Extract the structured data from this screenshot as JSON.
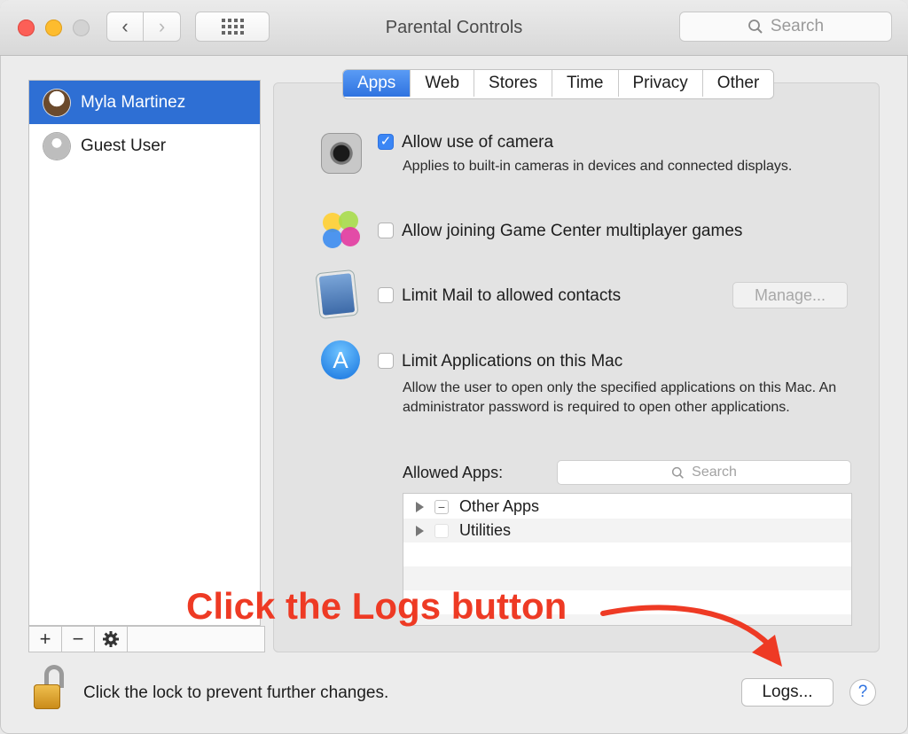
{
  "window": {
    "title": "Parental Controls"
  },
  "toolbar": {
    "search_placeholder": "Search",
    "back_glyph": "‹",
    "forward_glyph": "›"
  },
  "sidebar": {
    "users": [
      {
        "name": "Myla Martinez",
        "selected": true,
        "avatar": "eagle-avatar"
      },
      {
        "name": "Guest User",
        "selected": false,
        "avatar": "guest-avatar"
      }
    ],
    "add_label": "+",
    "remove_label": "−",
    "gear_label": "✱"
  },
  "tabs": [
    {
      "label": "Apps",
      "active": true
    },
    {
      "label": "Web",
      "active": false
    },
    {
      "label": "Stores",
      "active": false
    },
    {
      "label": "Time",
      "active": false
    },
    {
      "label": "Privacy",
      "active": false
    },
    {
      "label": "Other",
      "active": false
    }
  ],
  "apps": {
    "camera": {
      "label": "Allow use of camera",
      "checked": true,
      "desc": "Applies to built-in cameras in devices and connected displays."
    },
    "gamecenter": {
      "label": "Allow joining Game Center multiplayer games",
      "checked": false
    },
    "mail": {
      "label": "Limit Mail to allowed contacts",
      "checked": false,
      "manage_label": "Manage..."
    },
    "applications": {
      "label": "Limit Applications on this Mac",
      "checked": false,
      "desc": "Allow the user to open only the specified applications on this Mac. An administrator password is required to open other applications."
    },
    "allowed_apps_label": "Allowed Apps:",
    "allowed_search_placeholder": "Search",
    "allowed_list": [
      {
        "name": "Other Apps",
        "state": "mixed",
        "mark": "−"
      },
      {
        "name": "Utilities",
        "state": "unchecked",
        "mark": ""
      }
    ]
  },
  "footer": {
    "lock_text": "Click the lock to prevent further changes.",
    "logs_label": "Logs...",
    "help_label": "?"
  },
  "annotation": {
    "text": "Click the Logs button",
    "color": "#ee3a24"
  },
  "colors": {
    "accent": "#2e6fd4",
    "tab_active": "#2f73e0"
  }
}
